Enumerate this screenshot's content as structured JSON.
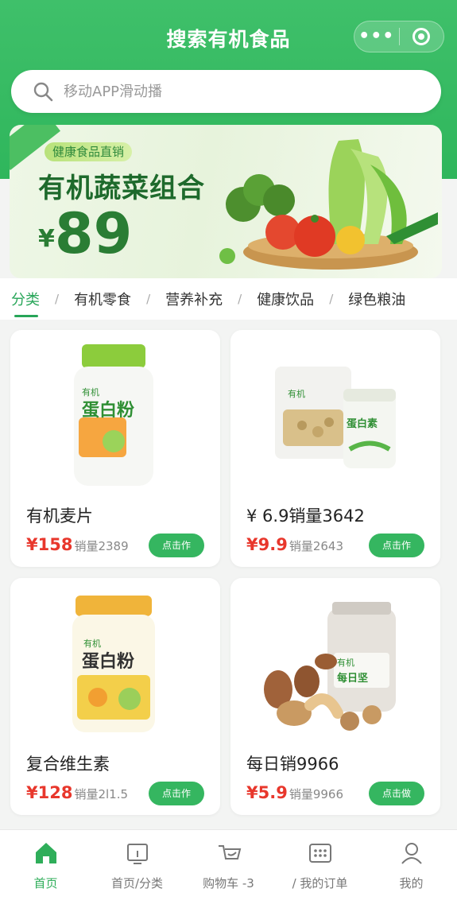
{
  "header": {
    "title": "搜索有机食品",
    "more_label": "•••"
  },
  "search": {
    "placeholder": "移动APP滑动播"
  },
  "banner": {
    "tag": "健康食品直销",
    "headline": "有机蔬菜组合",
    "currency": "¥",
    "price": "89"
  },
  "tabs": [
    {
      "label": "分类",
      "active": true
    },
    {
      "label": "有机零食"
    },
    {
      "label": "营养补充"
    },
    {
      "label": "健康饮品"
    },
    {
      "label": "绿色粮油"
    }
  ],
  "tab_separator": "/",
  "products": [
    {
      "name": "有机麦片",
      "price": "¥158",
      "sales": "销量2389",
      "button": "点击作",
      "pack_label": "蛋白粉",
      "brand": "有机"
    },
    {
      "name": "¥ 6.9销量3642",
      "price": "¥9.9",
      "sales": "销量2643",
      "button": "点击作",
      "pack_label": "蛋白素",
      "brand": "有机"
    },
    {
      "name": "复合维生素",
      "price": "¥128",
      "sales": "销量2l1.5",
      "button": "点击作",
      "pack_label": "蛋白粉",
      "brand": "有机"
    },
    {
      "name": "每日销9966",
      "price": "¥5.9",
      "sales": "销量9966",
      "button": "点击做",
      "pack_label": "每日坚",
      "brand": "有机"
    }
  ],
  "nav": [
    {
      "label": "首页",
      "icon": "home-icon",
      "active": true
    },
    {
      "label": "首页/分类",
      "icon": "category-icon"
    },
    {
      "label": "购物车 -3",
      "icon": "cart-icon"
    },
    {
      "label": "/ 我的订单",
      "icon": "orders-icon"
    },
    {
      "label": "我的",
      "icon": "profile-icon"
    }
  ],
  "colors": {
    "brand_green": "#2fb65c",
    "price_red": "#e8372c",
    "button_green": "#35b660"
  }
}
